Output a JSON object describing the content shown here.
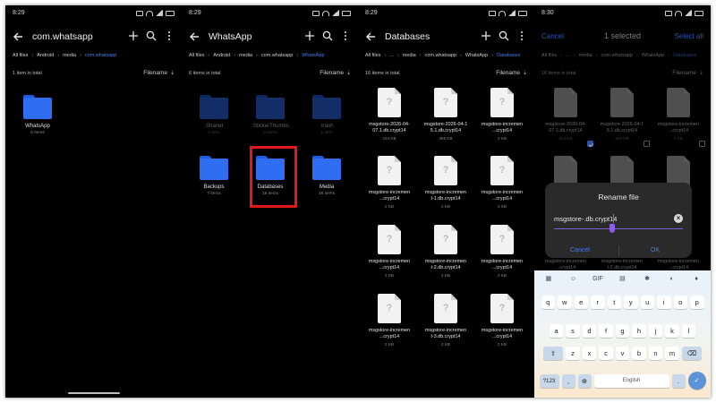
{
  "panel1": {
    "time": "8:29",
    "title": "com.whatsapp",
    "crumbs": [
      "All files",
      "Android",
      "media",
      "com.whatsapp"
    ],
    "count": "1 item in total",
    "sort": "Filename",
    "folders": [
      {
        "name": "WhatsApp",
        "sub": "6 items"
      }
    ]
  },
  "panel2": {
    "time": "8:29",
    "title": "WhatsApp",
    "crumbs": [
      "All files",
      "Android",
      "media",
      "com.whatsapp",
      "WhatsApp"
    ],
    "count": "6 items in total",
    "sort": "Filename",
    "folders": [
      {
        "name": ".Shared",
        "sub": "1 item"
      },
      {
        "name": ".StickerThumbs",
        "sub": "0 items"
      },
      {
        "name": ".trash",
        "sub": "1 item"
      },
      {
        "name": "Backups",
        "sub": "7 items"
      },
      {
        "name": "Databases",
        "sub": "16 items"
      },
      {
        "name": "Media",
        "sub": "16 items"
      }
    ]
  },
  "panel3": {
    "time": "8:29",
    "title": "Databases",
    "crumbs": [
      "All files",
      "...",
      "media",
      "com.whatsapp",
      "WhatsApp",
      "Databases"
    ],
    "count": "16 items in total",
    "sort": "Filename",
    "files": [
      {
        "name": "msgstore-2026-04-\n07.1.db.crypt14",
        "size": "314 KB"
      },
      {
        "name": "msgstore-2026-04-1\n5.1.db.crypt14",
        "size": "395 KB"
      },
      {
        "name": "msgstore-incremen\n...crypt14",
        "size": "2 KB"
      },
      {
        "name": "msgstore-incremen\n...crypt14",
        "size": "2 KB"
      },
      {
        "name": "msgstore-incremen\nt-1.db.crypt14",
        "size": "2 KB"
      },
      {
        "name": "msgstore-incremen\n...crypt14",
        "size": "2 KB"
      },
      {
        "name": "msgstore-incremen\n...crypt14",
        "size": "2 KB"
      },
      {
        "name": "msgstore-incremen\nt-2.db.crypt14",
        "size": "2 KB"
      },
      {
        "name": "msgstore-incremen\n...crypt14",
        "size": "2 KB"
      },
      {
        "name": "msgstore-incremen\n...crypt14",
        "size": "2 KB"
      },
      {
        "name": "msgstore-incremen\nt-3.db.crypt14",
        "size": "2 KB"
      },
      {
        "name": "msgstore-incremen\n...crypt14",
        "size": "2 KB"
      }
    ]
  },
  "panel4": {
    "time": "8:30",
    "cancel": "Cancel",
    "title": "1 selected",
    "select_all": "Select all",
    "crumbs": [
      "All files",
      "...",
      "media",
      "com.whatsapp",
      "WhatsApp",
      "Databases"
    ],
    "count": "16 items in total",
    "sort": "Filename",
    "files": [
      {
        "name": "msgstore-2026-04-\n07.1.db.crypt14",
        "size": "314 KB",
        "checked": true
      },
      {
        "name": "msgstore-2026-04-1\n5.1.db.crypt14",
        "size": "395 KB",
        "checked": false
      },
      {
        "name": "msgstore-incremen\n...crypt14",
        "size": "2 KB",
        "checked": false
      },
      {
        "name": "",
        "size": "",
        "checked": false
      },
      {
        "name": "",
        "size": "",
        "checked": false
      },
      {
        "name": "",
        "size": "",
        "checked": false
      },
      {
        "name": "msgstore-incremen\n...crypt14",
        "size": "2 KB",
        "checked": false
      },
      {
        "name": "msgstore-incremen\nt-2.db.crypt14",
        "size": "2 KB",
        "checked": false
      },
      {
        "name": "msgstore-incremen\n...crypt14",
        "size": "2 KB",
        "checked": false
      }
    ],
    "dialog": {
      "title": "Rename file",
      "value": "msgstore-.db.crypt14",
      "ghost": "",
      "cancel": "Cancel",
      "ok": "OK"
    },
    "keyboard": {
      "toolbar": [
        "grid",
        "sticker",
        "GIF",
        "clipboard",
        "settings",
        "palette",
        "mic"
      ],
      "row1": [
        "q",
        "w",
        "e",
        "r",
        "t",
        "y",
        "u",
        "i",
        "o",
        "p"
      ],
      "row2": [
        "a",
        "s",
        "d",
        "f",
        "g",
        "h",
        "j",
        "k",
        "l"
      ],
      "row3": [
        "z",
        "x",
        "c",
        "v",
        "b",
        "n",
        "m"
      ],
      "sym": "?123",
      "space": "English",
      "comma": ",",
      "period": "."
    }
  },
  "colors": {
    "accent": "#2f6df2",
    "link": "#4a7cf0",
    "highlight": "#e01818"
  }
}
